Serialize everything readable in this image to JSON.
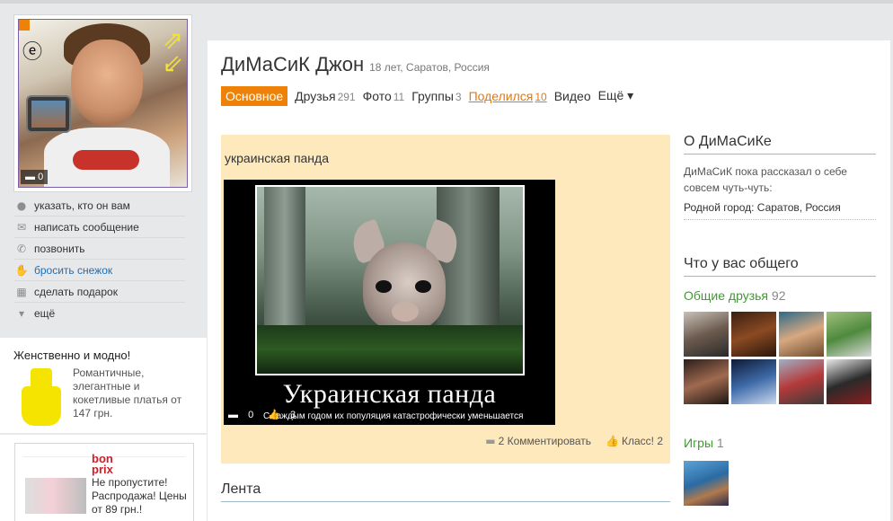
{
  "profile": {
    "name": "ДиМаСиК Джон",
    "meta": "18 лет, Саратов, Россия",
    "avatar_comments": "0"
  },
  "nav": [
    {
      "label": "Основное",
      "count": ""
    },
    {
      "label": "Друзья",
      "count": "291"
    },
    {
      "label": "Фото",
      "count": "11"
    },
    {
      "label": "Группы",
      "count": "3"
    },
    {
      "label": "Поделился",
      "count": "10"
    },
    {
      "label": "Видео",
      "count": ""
    },
    {
      "label": "Ещё ▾",
      "count": ""
    }
  ],
  "actions": [
    {
      "label": "указать, кто он вам",
      "icon": "location-pin-icon"
    },
    {
      "label": "написать сообщение",
      "icon": "envelope-icon"
    },
    {
      "label": "позвонить",
      "icon": "phone-icon"
    },
    {
      "label": "бросить снежок",
      "icon": "snowball-glove-icon"
    },
    {
      "label": "сделать подарок",
      "icon": "gift-icon"
    },
    {
      "label": "ещё",
      "icon": "chevron-down-icon"
    }
  ],
  "ads": {
    "ad1": {
      "title": "Женственно и модно!",
      "text": "Романтичные, элегантные и кокетливые платья от 147 грн."
    },
    "ad2": {
      "brand_line1": "bon",
      "brand_line2": "prix",
      "text": "Не пропустите! Распродажа! Цены от 89 грн.!"
    }
  },
  "post": {
    "title": "украинская панда",
    "image_caption": "Украинская панда",
    "image_subcaption": "С каждым годом их популяция катастрофически уменьшается",
    "image_comments": "0",
    "image_likes": "3",
    "comment_label": "2 Комментировать",
    "like_label": "Класс! 2"
  },
  "feed": {
    "title": "Лента"
  },
  "about": {
    "title": "О ДиМаСиКе",
    "text": "ДиМаСиК пока рассказал о себе совсем чуть-чуть:",
    "city": "Родной город: Саратов, Россия"
  },
  "common": {
    "title": "Что у вас общего",
    "friends_label": "Общие друзья",
    "friends_count": "92",
    "games_label": "Игры",
    "games_count": "1"
  },
  "colors": {
    "accent": "#ee8208",
    "green_link": "#3e9a2e",
    "post_bg": "#fde9bb"
  }
}
